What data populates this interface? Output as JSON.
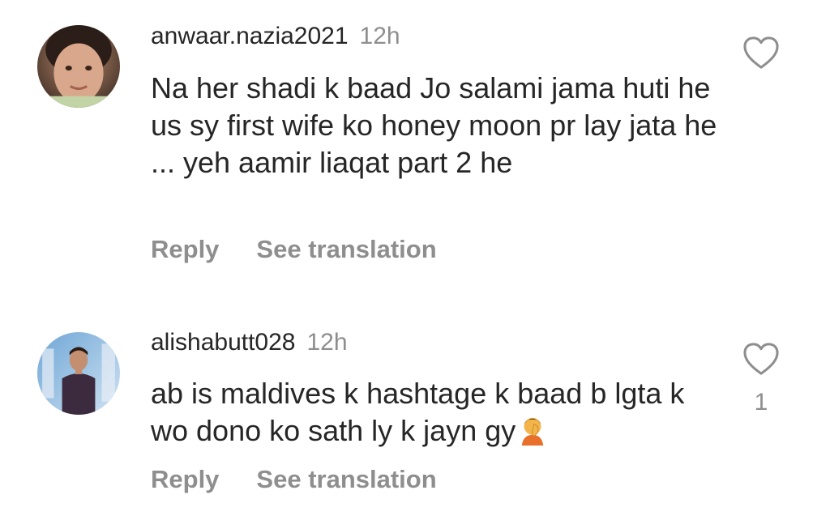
{
  "comments": [
    {
      "username": "anwaar.nazia2021",
      "time": "12h",
      "text": "Na her shadi k baad Jo salami jama huti he us sy first wife ko honey moon pr lay jata he ... yeh aamir liaqat part 2 he",
      "reply_label": "Reply",
      "translate_label": "See translation",
      "avatar_icon": "child-portrait"
    },
    {
      "username": "alishabutt028",
      "time": "12h",
      "text": "ab is maldives k hashtage k baad b lgta k wo dono ko sath ly k jayn gy",
      "emoji_icon": "person-facepalming-emoji",
      "like_count": "1",
      "reply_label": "Reply",
      "translate_label": "See translation",
      "avatar_icon": "man-portrait"
    }
  ],
  "colors": {
    "text": "#262626",
    "secondary": "#8e8e8e",
    "background": "#ffffff"
  }
}
